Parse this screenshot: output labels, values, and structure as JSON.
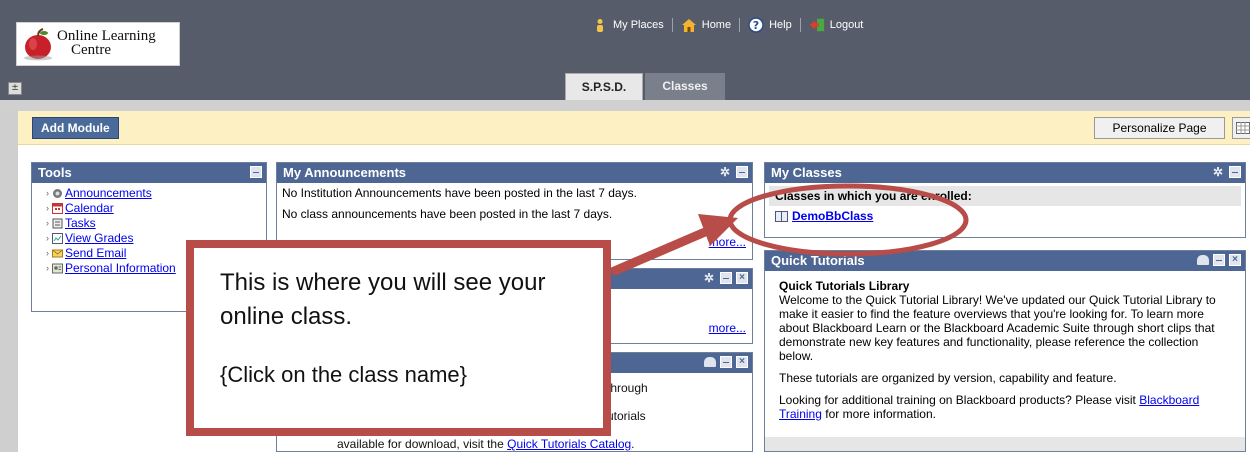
{
  "header": {
    "logo_line1": "Online Learning",
    "logo_line2": "Centre",
    "links": [
      {
        "label": "My Places",
        "icon": "person-icon"
      },
      {
        "label": "Home",
        "icon": "home-icon"
      },
      {
        "label": "Help",
        "icon": "help-icon"
      },
      {
        "label": "Logout",
        "icon": "logout-icon"
      }
    ],
    "tabs": [
      {
        "label": "S.P.S.D.",
        "active": true
      },
      {
        "label": "Classes",
        "active": false
      }
    ]
  },
  "toolbar": {
    "add_module": "Add Module",
    "personalize": "Personalize Page"
  },
  "tools": {
    "title": "Tools",
    "items": [
      {
        "label": "Announcements",
        "icon": "announcements-icon"
      },
      {
        "label": "Calendar",
        "icon": "calendar-icon"
      },
      {
        "label": "Tasks",
        "icon": "tasks-icon"
      },
      {
        "label": "View Grades",
        "icon": "grades-icon"
      },
      {
        "label": "Send Email",
        "icon": "email-icon"
      },
      {
        "label": "Personal Information",
        "icon": "personal-info-icon"
      }
    ]
  },
  "announcements": {
    "title": "My Announcements",
    "line1": "No Institution Announcements have been posted in the last 7 days.",
    "line2": "No class announcements have been posted in the last 7 days.",
    "more": "more..."
  },
  "module2": {
    "more": "more..."
  },
  "module3": {
    "text1": "through",
    "text2": "utorials",
    "bottom_prefix": "available for download, visit the",
    "bottom_link": "Quick Tutorials Catalog",
    "bottom_suffix": "."
  },
  "classes": {
    "title": "My Classes",
    "subtitle": "Classes in which you are enrolled:",
    "class_name": "DemoBbClass"
  },
  "quick": {
    "title": "Quick Tutorials",
    "heading": "Quick Tutorials Library",
    "p1": "Welcome to the Quick Tutorial Library! We've updated our Quick Tutorial Library to make it easier to find the feature overviews that you're looking for. To learn more about Blackboard Learn or the Blackboard Academic Suite through short clips that demonstrate new key features and functionality, please reference the collection below.",
    "p2": "These tutorials are organized by version, capability and feature.",
    "p3_prefix": "Looking for additional training on Blackboard products? Please visit",
    "p3_link": "Blackboard Training",
    "p3_suffix": "for more information."
  },
  "callout": {
    "line1": "This is where you will see your online class.",
    "line2": "{Click on the class name}"
  },
  "colors": {
    "header_bg": "#575c6b",
    "module_head": "#4e6693",
    "callout_red": "#b84c49",
    "module_bar": "#fdf1c4"
  }
}
